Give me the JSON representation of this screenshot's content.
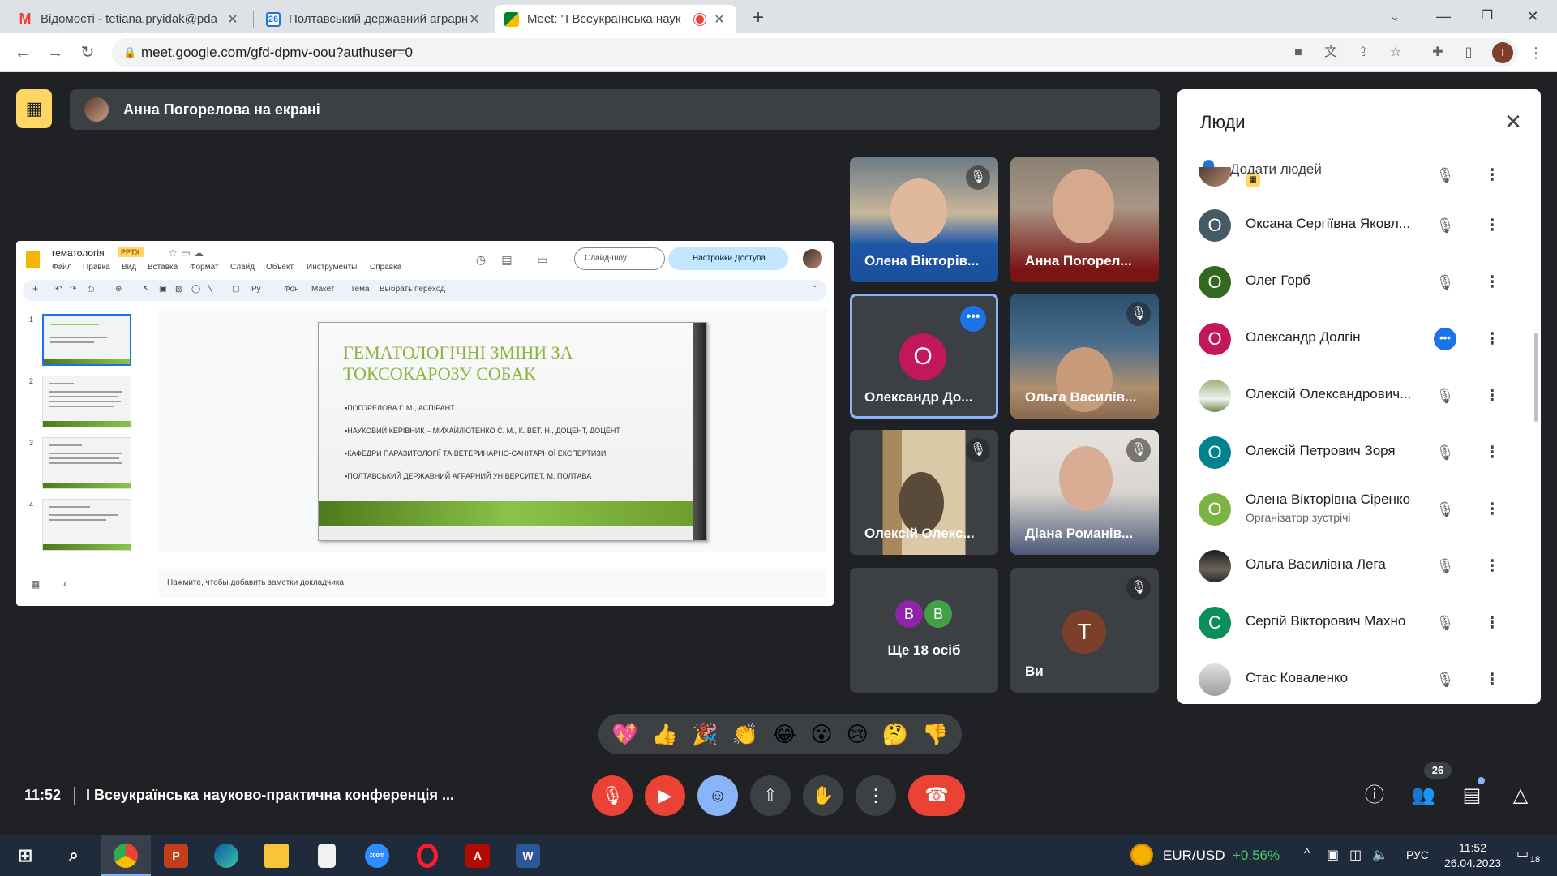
{
  "browser": {
    "tabs": [
      {
        "icon": "gmail-icon",
        "title": "Відомості - tetiana.pryidak@pda"
      },
      {
        "icon": "calendar-icon",
        "title": "Полтавський державний аграрн"
      },
      {
        "icon": "meet-icon",
        "title": "Meet: \"І Всеукраїнська наук",
        "recording": true
      }
    ],
    "url": "meet.google.com/gfd-dpmv-oou?authuser=0",
    "profile_initial": "T"
  },
  "meet": {
    "presenter_banner": "Анна Погорелова на екрані",
    "shared_screen": {
      "doc_title": "гематологія",
      "doc_badge": "PPTX",
      "menu": [
        "Файл",
        "Правка",
        "Вид",
        "Вставка",
        "Формат",
        "Слайд",
        "Объект",
        "Инструменты",
        "Справка"
      ],
      "slideshow_label": "Слайд-шоу",
      "access_label": "Настройки Доступа",
      "toolbar": {
        "bg": "Фон",
        "layout": "Макет",
        "theme": "Тема",
        "transition": "Выбрать переход"
      },
      "thumb_numbers": [
        "1",
        "2",
        "3",
        "4"
      ],
      "slide_title": "ГЕМАТОЛОГІЧНІ ЗМІНИ ЗА ТОКСОКАРОЗУ СОБАК",
      "slide_lines": [
        "▪ПОГОРЕЛОВА Г. М., АСПІРАНТ",
        "▪НАУКОВИЙ КЕРІВНИК – МИХАЙЛЮТЕНКО С. М., К. ВЕТ. Н., ДОЦЕНТ, ДОЦЕНТ",
        "▪КАФЕДРИ ПАРАЗИТОЛОГІЇ ТА ВЕТЕРИНАРНО-САНІТАРНОЇ ЕКСПЕРТИЗИ,",
        "▪ПОЛТАВСЬКИЙ ДЕРЖАВНИЙ АГРАРНИЙ УНІВЕРСИТЕТ, М. ПОЛТАВА"
      ],
      "notes_placeholder": "Нажмите, чтобы добавить заметки докладчика"
    },
    "tiles": [
      {
        "name": "Олена Вікторів...",
        "muted": true
      },
      {
        "name": "Анна Погорел...",
        "muted": false
      },
      {
        "name": "Олександр До...",
        "initial": "О",
        "speaking": true
      },
      {
        "name": "Ольга Василів...",
        "muted": true
      },
      {
        "name": "Олексій Олекс...",
        "muted": true
      },
      {
        "name": "Діана Романів...",
        "muted": true
      },
      {
        "name": "Ще 18 осіб",
        "initials": [
          "В",
          "В"
        ]
      },
      {
        "name": "Ви",
        "initial": "Т",
        "muted": true
      }
    ],
    "people_panel": {
      "title": "Люди",
      "add_label": "Додати людей",
      "participants": [
        {
          "name": "Оксана Сергіївна Яковл...",
          "initial": "О",
          "color": "#455a64",
          "status": "muted"
        },
        {
          "name": "Олег Горб",
          "initial": "О",
          "color": "#33691e",
          "status": "muted"
        },
        {
          "name": "Олександр Долгін",
          "initial": "О",
          "color": "#c2185b",
          "status": "speaking"
        },
        {
          "name": "Олексій Олександрович...",
          "initial": "",
          "color": "#8d9e7a",
          "status": "muted"
        },
        {
          "name": "Олексій Петрович Зоря",
          "initial": "О",
          "color": "#00838f",
          "status": "muted"
        },
        {
          "name": "Олена Вікторівна Сіренко",
          "sub": "Організатор зустрічі",
          "initial": "О",
          "color": "#7cb342",
          "status": "muted"
        },
        {
          "name": "Ольга Василівна Лега",
          "initial": "",
          "color": "#2b2b2b",
          "status": "muted"
        },
        {
          "name": "Сергій Вікторович Махно",
          "initial": "С",
          "color": "#0a8f5a",
          "status": "muted"
        },
        {
          "name": "Стас Коваленко",
          "initial": "",
          "color": "#9e9e9e",
          "status": "muted"
        }
      ]
    },
    "reactions": [
      "💖",
      "👍",
      "🎉",
      "👏",
      "😂",
      "😮",
      "😢",
      "🤔",
      "👎"
    ],
    "bottom": {
      "time": "11:52",
      "meeting_name": "І Всеукраїнська науково-практична конференція ...",
      "people_count": "26"
    }
  },
  "taskbar": {
    "ticker": "EUR/USD",
    "ticker_change": "+0.56%",
    "lang": "РУС",
    "time": "11:52",
    "date": "26.04.2023",
    "notifications": "18"
  }
}
